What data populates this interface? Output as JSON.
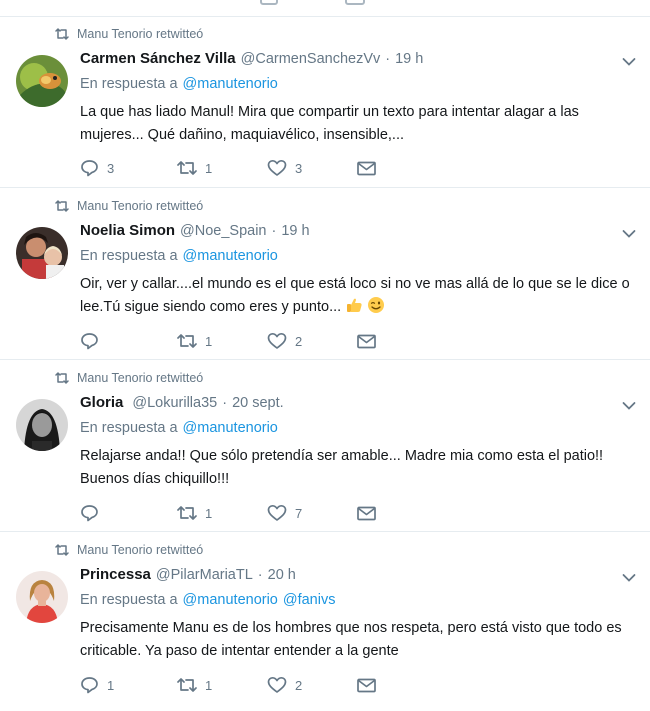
{
  "tweets": [
    {
      "retweet_label": "Manu Tenorio retwitteó",
      "name": "Carmen Sánchez Villa",
      "handle": "@CarmenSanchezVv",
      "dot": "·",
      "time": "19 h",
      "reply_prefix": "En respuesta a",
      "reply_to": "@manutenorio",
      "text": "La que has liado Manul! Mira que compartir un texto para intentar alagar a las mujeres... Qué dañino, maquiavélico, insensible,...",
      "replies": "3",
      "retweets": "1",
      "likes": "3"
    },
    {
      "retweet_label": "Manu Tenorio retwitteó",
      "name": "Noelia Simon",
      "handle": "@Noe_Spain",
      "dot": "·",
      "time": "19 h",
      "reply_prefix": "En respuesta a",
      "reply_to": "@manutenorio",
      "text": "Oir, ver y callar....el mundo es el que está loco si no ve mas allá de lo que se le dice o lee.Tú sigue siendo como eres y punto...",
      "emojis": [
        "thumbs-up-emoji",
        "winking-face-emoji"
      ],
      "replies": "",
      "retweets": "1",
      "likes": "2"
    },
    {
      "retweet_label": "Manu Tenorio retwitteó",
      "name": "Gloria",
      "handle": "@Lokurilla35",
      "dot": "·",
      "time": "20 sept.",
      "reply_prefix": "En respuesta a",
      "reply_to": "@manutenorio",
      "text": "Relajarse anda!! Que sólo pretendía ser amable... Madre mia como esta el patio!! Buenos días chiquillo!!!",
      "replies": "",
      "retweets": "1",
      "likes": "7"
    },
    {
      "retweet_label": "Manu Tenorio retwitteó",
      "name": "Princessa",
      "handle": "@PilarMariaTL",
      "dot": "·",
      "time": "20 h",
      "reply_prefix": "En respuesta a",
      "reply_to": "@manutenorio",
      "reply_to_2": "@fanivs",
      "text": "Precisamente Manu es de los hombres que nos respeta, pero está visto que todo es criticable. Ya paso de intentar entender a la gente",
      "replies": "1",
      "retweets": "1",
      "likes": "2"
    }
  ],
  "icons": {
    "retweet": "retweet-icon",
    "reply": "reply-icon",
    "like": "heart-icon",
    "dm": "envelope-icon",
    "more": "chevron-down-icon"
  },
  "colors": {
    "text": "#14171a",
    "secondary": "#657786",
    "link": "#1b95e0",
    "divider": "#e6ecf0"
  }
}
